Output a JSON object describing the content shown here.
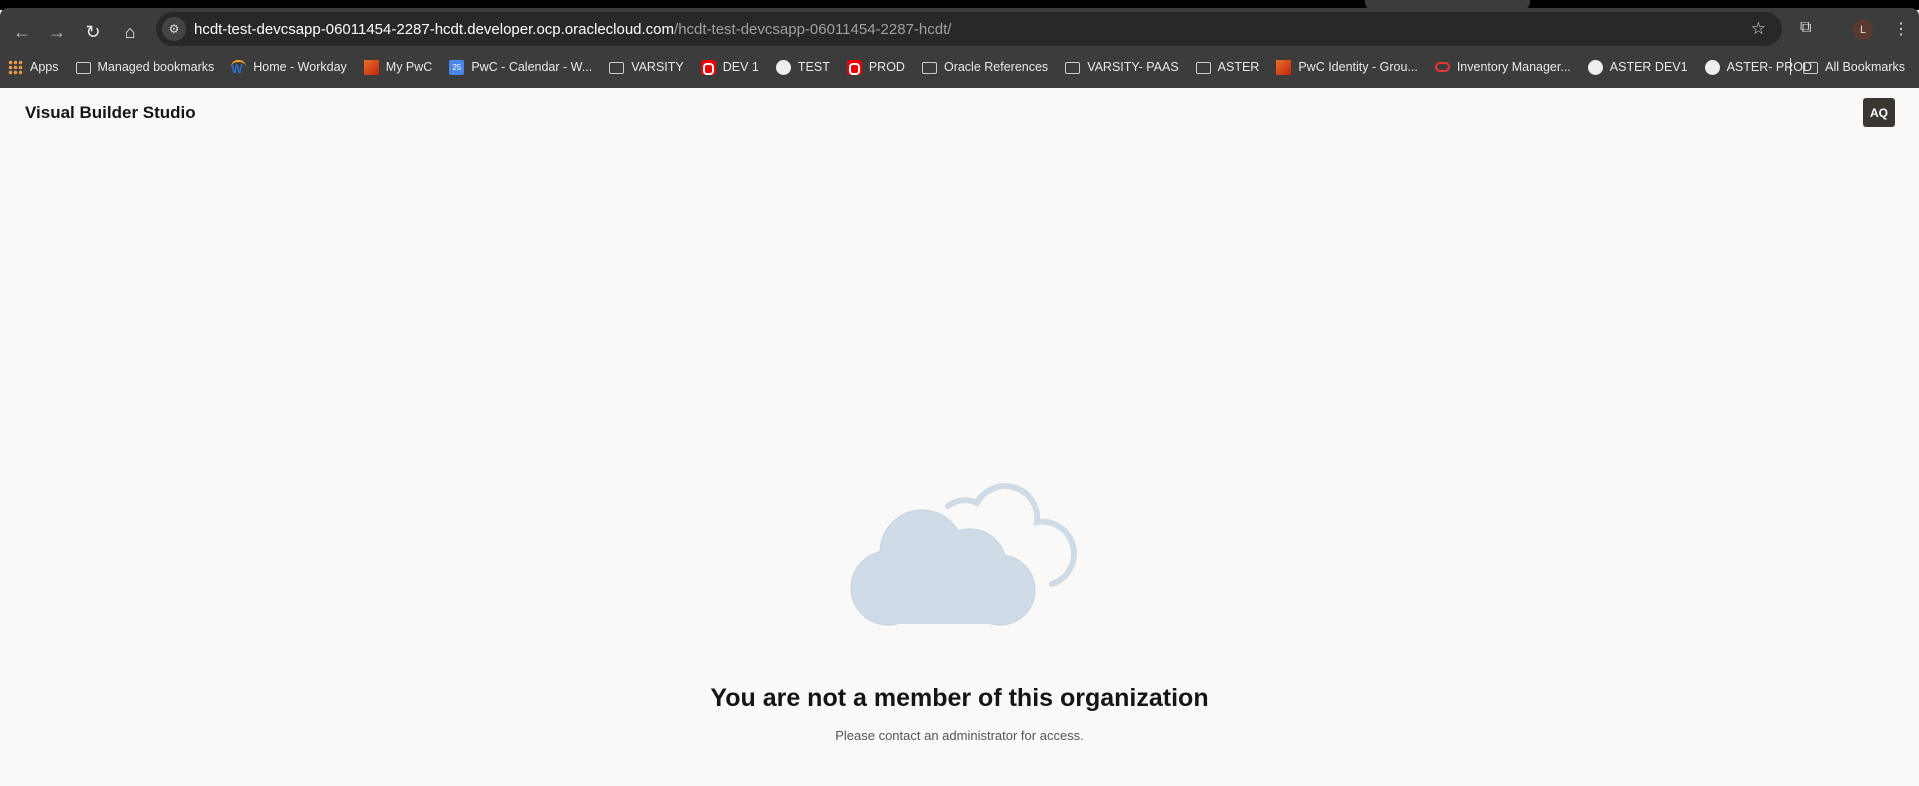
{
  "browser": {
    "url_host": "hcdt-test-devcsapp-06011454-2287-hcdt.developer.ocp.oraclecloud.com",
    "url_path": "/hcdt-test-devcsapp-06011454-2287-hcdt/",
    "profile_initial": "L",
    "bookmarks": [
      {
        "label": "Apps",
        "icon": "apps"
      },
      {
        "label": "Managed bookmarks",
        "icon": "folder"
      },
      {
        "label": "Home - Workday",
        "icon": "workday"
      },
      {
        "label": "My PwC",
        "icon": "pwc"
      },
      {
        "label": "PwC - Calendar - W...",
        "icon": "calendar"
      },
      {
        "label": "VARSITY",
        "icon": "folder"
      },
      {
        "label": "DEV 1",
        "icon": "oracle"
      },
      {
        "label": "TEST",
        "icon": "globe"
      },
      {
        "label": "PROD",
        "icon": "oracle"
      },
      {
        "label": "Oracle References",
        "icon": "folder"
      },
      {
        "label": "VARSITY- PAAS",
        "icon": "folder"
      },
      {
        "label": "ASTER",
        "icon": "folder"
      },
      {
        "label": "PwC Identity - Grou...",
        "icon": "pwc"
      },
      {
        "label": "Inventory Manager...",
        "icon": "oracle-ring"
      },
      {
        "label": "ASTER DEV1",
        "icon": "globe"
      },
      {
        "label": "ASTER- PROD",
        "icon": "globe"
      }
    ],
    "all_bookmarks": "All Bookmarks",
    "calendar_day": "25"
  },
  "app": {
    "title": "Visual Builder Studio",
    "user_initials": "AQ"
  },
  "message": {
    "heading": "You are not a member of this organization",
    "subtext": "Please contact an administrator for access."
  },
  "colors": {
    "cloud": "#cfdbe6",
    "accent_dark": "#3a3632"
  }
}
